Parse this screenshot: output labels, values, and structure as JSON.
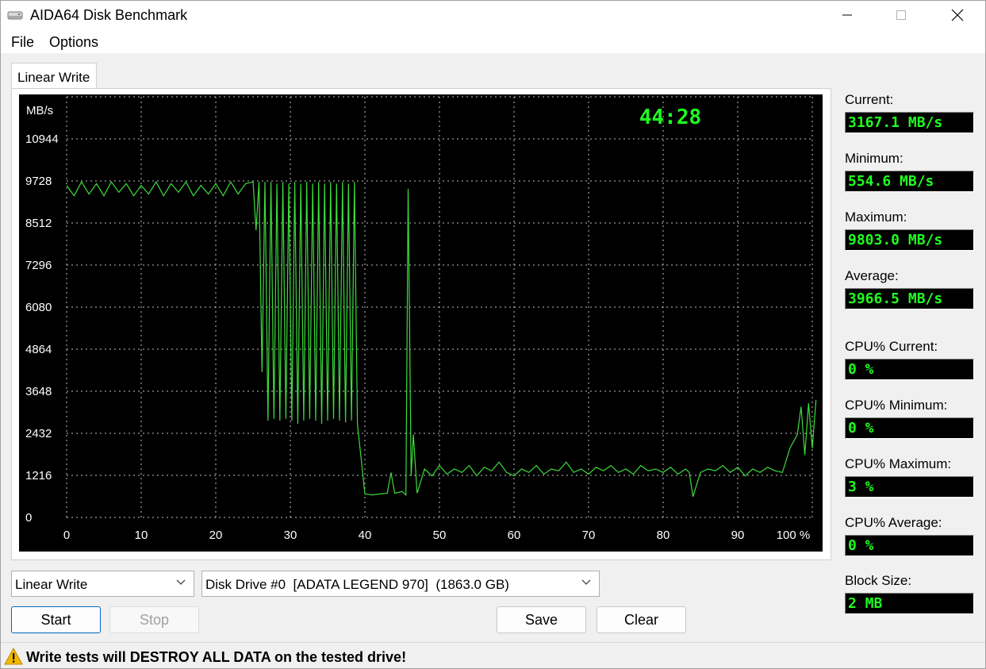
{
  "window": {
    "title": "AIDA64 Disk Benchmark",
    "icons": {
      "app": "disk-drive-icon",
      "minimize": "minimize-icon",
      "maximize": "maximize-icon",
      "close": "close-icon"
    }
  },
  "menu": {
    "file": "File",
    "options": "Options"
  },
  "tab": {
    "label": "Linear Write"
  },
  "chart_data": {
    "type": "line",
    "ylabel": "MB/s",
    "timer": "44:28",
    "x_unit": "%",
    "xlim": [
      0,
      100
    ],
    "ylim": [
      0,
      12160
    ],
    "xticks": [
      0,
      10,
      20,
      30,
      40,
      50,
      60,
      70,
      80,
      90,
      100
    ],
    "xtick_labels": [
      "0",
      "10",
      "20",
      "30",
      "40",
      "50",
      "60",
      "70",
      "80",
      "90",
      "100 %"
    ],
    "yticks": [
      0,
      1216,
      2432,
      3648,
      4864,
      6080,
      7296,
      8512,
      9728,
      10944
    ],
    "grid": true,
    "colors": {
      "background": "#000000",
      "line": "#3ddc3d",
      "grid": "#c0c0c0",
      "timer": "#20ff20",
      "text": "#ffffff"
    },
    "series": [
      {
        "x": [
          0,
          1,
          2,
          3,
          4,
          5,
          6,
          7,
          8,
          9,
          10,
          11,
          12,
          13,
          14,
          15,
          16,
          17,
          18,
          19,
          20,
          21,
          22,
          23,
          24,
          25,
          25.4,
          25.8,
          26.2,
          26.6,
          27.0,
          27.4,
          27.8,
          28.2,
          28.6,
          29.0,
          29.4,
          29.8,
          30.2,
          30.6,
          31.0,
          31.4,
          31.8,
          32.2,
          32.6,
          33.0,
          33.4,
          33.8,
          34.2,
          34.6,
          35.0,
          35.4,
          35.8,
          36.2,
          36.6,
          37.0,
          37.4,
          37.8,
          38.2,
          38.6,
          39.0,
          40,
          41,
          42,
          43,
          43.5,
          44,
          45,
          45.5,
          45.8,
          46.2,
          46.5,
          47,
          48,
          49,
          50,
          51,
          52,
          53,
          54,
          55,
          56,
          57,
          58,
          59,
          60,
          61,
          62,
          63,
          64,
          65,
          66,
          67,
          68,
          69,
          70,
          71,
          72,
          73,
          74,
          75,
          76,
          77,
          78,
          79,
          80,
          81,
          82,
          83,
          83.5,
          84,
          85,
          86,
          87,
          88,
          89,
          90,
          91,
          92,
          93,
          94,
          95,
          96,
          97,
          98,
          98.5,
          99,
          99.5,
          100,
          100.5
        ],
        "y": [
          9600,
          9300,
          9700,
          9350,
          9650,
          9300,
          9700,
          9400,
          9650,
          9300,
          9600,
          9350,
          9700,
          9300,
          9650,
          9400,
          9700,
          9300,
          9600,
          9350,
          9650,
          9300,
          9700,
          9350,
          9650,
          9700,
          8300,
          9700,
          4200,
          9700,
          2800,
          9700,
          2850,
          9650,
          2800,
          9700,
          2850,
          9650,
          2800,
          9700,
          2700,
          9650,
          2800,
          9700,
          2850,
          9650,
          2800,
          9700,
          2700,
          9650,
          2800,
          9700,
          2850,
          9650,
          2800,
          9700,
          2750,
          9650,
          2800,
          9700,
          2700,
          680,
          650,
          680,
          700,
          1300,
          700,
          750,
          650,
          9500,
          1200,
          2400,
          700,
          1400,
          1200,
          1500,
          1250,
          1400,
          1300,
          1500,
          1200,
          1450,
          1350,
          1600,
          1300,
          1200,
          1400,
          1300,
          1500,
          1250,
          1400,
          1350,
          1600,
          1300,
          1400,
          1250,
          1450,
          1350,
          1500,
          1300,
          1400,
          1250,
          1500,
          1350,
          1400,
          1300,
          1450,
          1250,
          1400,
          1300,
          600,
          1300,
          1400,
          1350,
          1500,
          1300,
          1450,
          1200,
          1400,
          1300,
          1450,
          1350,
          1300,
          2000,
          2400,
          3200,
          1800,
          3300,
          2000,
          3400
        ]
      }
    ]
  },
  "stats": [
    {
      "label": "Current:",
      "value": "3167.1 MB/s"
    },
    {
      "label": "Minimum:",
      "value": "554.6 MB/s"
    },
    {
      "label": "Maximum:",
      "value": "9803.0 MB/s"
    },
    {
      "label": "Average:",
      "value": "3966.5 MB/s"
    },
    {
      "label": "CPU% Current:",
      "value": "0 %"
    },
    {
      "label": "CPU% Minimum:",
      "value": "0 %"
    },
    {
      "label": "CPU% Maximum:",
      "value": "3 %"
    },
    {
      "label": "CPU% Average:",
      "value": "0 %"
    },
    {
      "label": "Block Size:",
      "value": "2 MB"
    }
  ],
  "controls": {
    "test_select": "Linear Write",
    "drive_select": "Disk Drive #0  [ADATA LEGEND 970]  (1863.0 GB)",
    "chevron_icon": "chevron-down-icon",
    "start": "Start",
    "stop": "Stop",
    "save": "Save",
    "clear": "Clear"
  },
  "status": {
    "icon": "warning-icon",
    "text": "Write tests will DESTROY ALL DATA on the tested drive!"
  }
}
